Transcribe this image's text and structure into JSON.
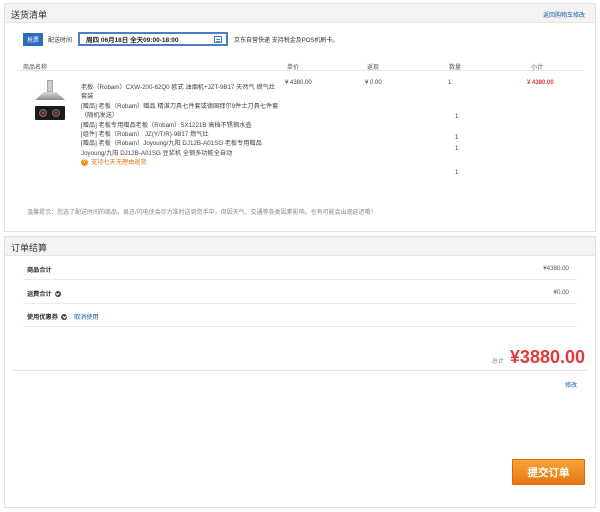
{
  "delivery_list": {
    "title": "送货清单",
    "back_link": "返回购物车修改",
    "badge": "抢票",
    "time_label": "配送时间",
    "date_value": "周四 06月18日 全天09:00-18:00",
    "note": "京东自营快递 支持税金及POS机刷卡。",
    "columns": [
      "商品名称",
      "单价",
      "返现",
      "数量",
      "小计"
    ],
    "product": {
      "image_icon": "range-hood-and-stove",
      "lines": [
        "老板（Robam）CXW-200-62Q0 欧式 油烟机+JZT-9B17 天然气 燃气灶套装",
        "[赠品] 老板（Robam）赠品 精湛刀具七件套或德国拜尔9件士刀具七件套（随机发送）",
        "[赠品] 老板专用赠品老板（Robam）SX1221B 高档不锈钢水壶",
        "[组件] 老板（Robam） JZ(Y/T/R)-9B17 燃气灶",
        "[赠品] 老板（Robam）Joyoung/九阳 DJ12B-A01SG 老板专用赠品 Joyoung/九阳 DJ12B-A01SG 豆浆机 全钢多功能全自动"
      ],
      "refund_icon": "question-circle-icon",
      "refund_text": "支持七天无理由退货",
      "price": "¥ 4380.00",
      "cashback": "¥ 0.00",
      "qty": "1",
      "gift_qtys": [
        "1",
        "1",
        "1",
        "1"
      ],
      "subtotal": "¥ 4380.00"
    },
    "tip": "温馨提示：您选了配送时间的商品，易迅/闪电侠会尽力准时送到您手中，但因天气、交通等各类因素影响，也有可能会出现延迟哦！"
  },
  "order_summary": {
    "title": "订单结算",
    "rows": [
      {
        "label": "商品合计",
        "amount": "¥4380.00"
      },
      {
        "label": "运费合计",
        "amount": "¥0.00"
      },
      {
        "label": "使用优惠券",
        "link": "取消使用"
      }
    ],
    "total_label": "总计",
    "total_value": "¥3880.00",
    "modify_link": "修改",
    "submit_label": "提交订单"
  },
  "colors": {
    "accent_red": "#e4393c",
    "link_blue": "#1a5ea8",
    "submit_orange": "#f08a1e"
  }
}
